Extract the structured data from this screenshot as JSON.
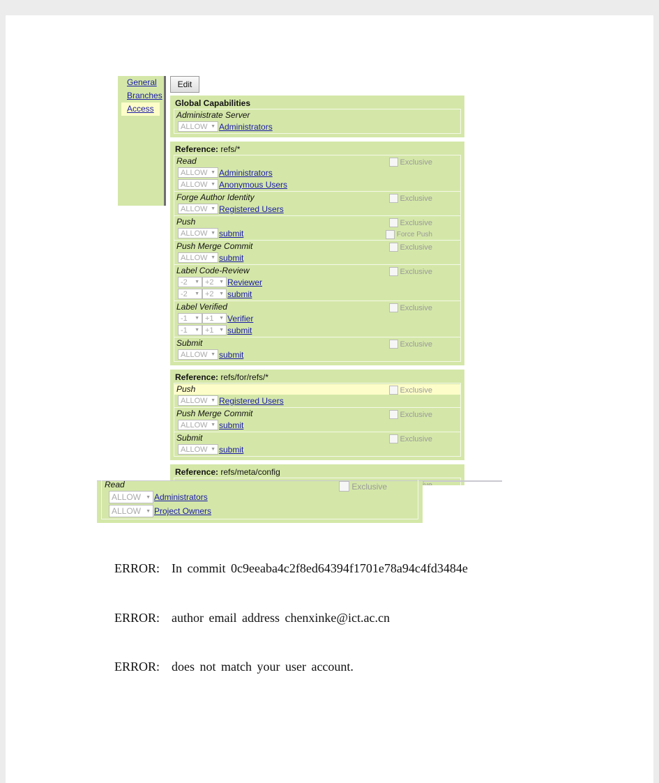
{
  "sidebar": {
    "items": [
      {
        "label": "General",
        "active": false
      },
      {
        "label": "Branches",
        "active": false
      },
      {
        "label": "Access",
        "active": true
      }
    ]
  },
  "toolbar": {
    "edit_label": "Edit"
  },
  "colors": {
    "panel_green": "#d4e7a8",
    "highlight": "#fdfdc9",
    "link": "#1a1aa6"
  },
  "sections": [
    {
      "title": "Global Capabilities",
      "path": "",
      "permissions": [
        {
          "name": "Administrate Server",
          "rules": [
            {
              "action": "ALLOW",
              "group": "Administrators"
            }
          ]
        }
      ]
    },
    {
      "title": "Reference:",
      "path": "refs/*",
      "permissions": [
        {
          "name": "Read",
          "exclusive": "Exclusive",
          "rules": [
            {
              "action": "ALLOW",
              "group": "Administrators"
            },
            {
              "action": "ALLOW",
              "group": "Anonymous Users"
            }
          ]
        },
        {
          "name": "Forge Author Identity",
          "exclusive": "Exclusive",
          "rules": [
            {
              "action": "ALLOW",
              "group": "Registered Users"
            }
          ]
        },
        {
          "name": "Push",
          "exclusive": "Exclusive",
          "extra": "Force Push",
          "rules": [
            {
              "action": "ALLOW",
              "group": "submit"
            }
          ]
        },
        {
          "name": "Push Merge Commit",
          "exclusive": "Exclusive",
          "rules": [
            {
              "action": "ALLOW",
              "group": "submit"
            }
          ]
        },
        {
          "name": "Label Code-Review",
          "exclusive": "Exclusive",
          "rules": [
            {
              "min": "-2",
              "max": "+2",
              "group": "Reviewer"
            },
            {
              "min": "-2",
              "max": "+2",
              "group": "submit"
            }
          ]
        },
        {
          "name": "Label Verified",
          "exclusive": "Exclusive",
          "rules": [
            {
              "min": "-1",
              "max": "+1",
              "group": "Verifier"
            },
            {
              "min": "-1",
              "max": "+1",
              "group": "submit"
            }
          ]
        },
        {
          "name": "Submit",
          "exclusive": "Exclusive",
          "rules": [
            {
              "action": "ALLOW",
              "group": "submit"
            }
          ]
        }
      ]
    },
    {
      "title": "Reference:",
      "path": "refs/for/refs/*",
      "permissions": [
        {
          "name": "Push",
          "exclusive": "Exclusive",
          "highlight": true,
          "rules": [
            {
              "action": "ALLOW",
              "group": "Registered Users"
            }
          ]
        },
        {
          "name": "Push Merge Commit",
          "exclusive": "Exclusive",
          "rules": [
            {
              "action": "ALLOW",
              "group": "submit"
            }
          ]
        },
        {
          "name": "Submit",
          "exclusive": "Exclusive",
          "rules": [
            {
              "action": "ALLOW",
              "group": "submit"
            }
          ]
        }
      ]
    },
    {
      "title": "Reference:",
      "path": "refs/meta/config",
      "permissions": [
        {
          "name": "Read",
          "exclusive": "Exclusive",
          "rules": []
        }
      ]
    }
  ],
  "overlay": {
    "name": "Read",
    "exclusive": "Exclusive",
    "rules": [
      {
        "action": "ALLOW",
        "group": "Administrators"
      },
      {
        "action": "ALLOW",
        "group": "Project Owners"
      }
    ]
  },
  "errors": [
    {
      "label": "ERROR:",
      "message": "In commit 0c9eeaba4c2f8ed64394f1701e78a94c4fd3484e"
    },
    {
      "label": "ERROR:",
      "message": "author email address chenxinke@ict.ac.cn"
    },
    {
      "label": "ERROR:",
      "message": "does not match your user account."
    }
  ]
}
